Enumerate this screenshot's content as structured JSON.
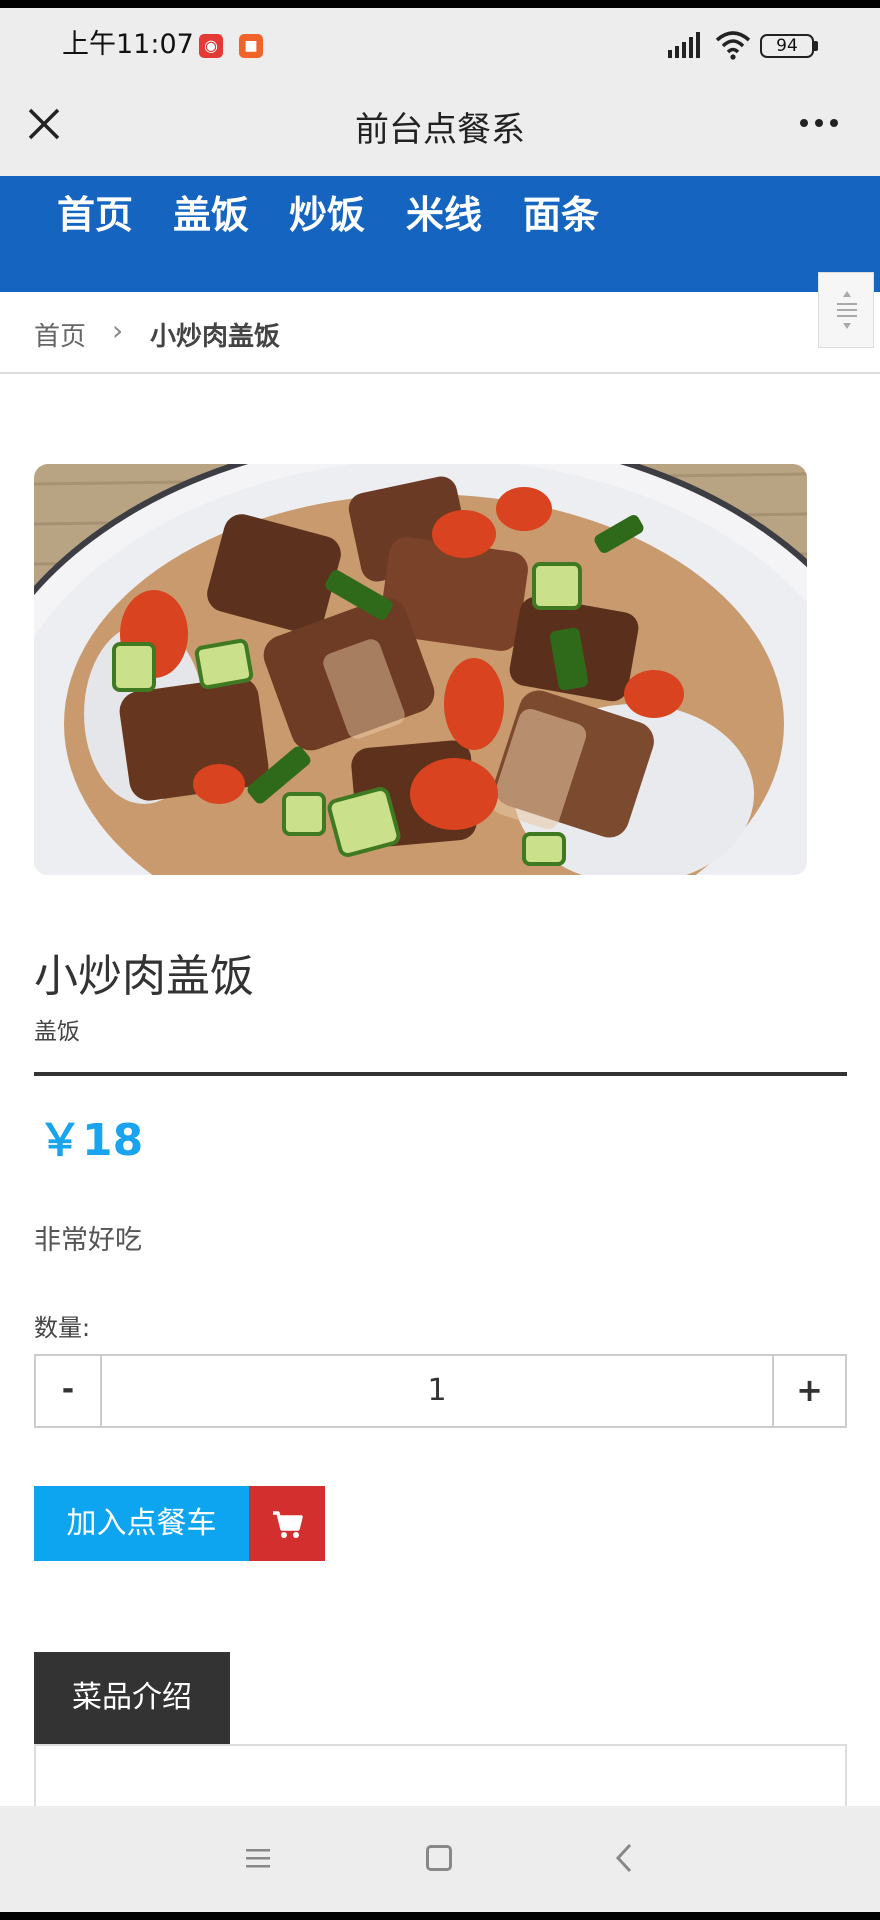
{
  "status_bar": {
    "time": "上午11:07",
    "battery": "94",
    "icons": [
      "netease-music-icon",
      "video-record-icon",
      "signal-icon",
      "wifi-icon",
      "battery-icon"
    ]
  },
  "navbar": {
    "title": "前台点餐系",
    "close_icon": "close-icon",
    "more_icon": "more-icon"
  },
  "categories": [
    "首页",
    "盖饭",
    "炒饭",
    "米线",
    "面条"
  ],
  "breadcrumb": {
    "home": "首页",
    "separator": "›",
    "current": "小炒肉盖饭"
  },
  "product": {
    "name": "小炒肉盖饭",
    "category": "盖饭",
    "price": "￥18",
    "description": "非常好吃",
    "quantity_label": "数量:",
    "quantity": "1",
    "minus": "-",
    "plus": "+",
    "add_to_cart": "加入点餐车"
  },
  "tabs": {
    "intro": "菜品介绍"
  },
  "colors": {
    "category_bar": "#1565c0",
    "price": "#1aa3ee",
    "add_button": "#0ea5f0",
    "cart_button": "#d32f2f",
    "tab_active": "#333333"
  }
}
